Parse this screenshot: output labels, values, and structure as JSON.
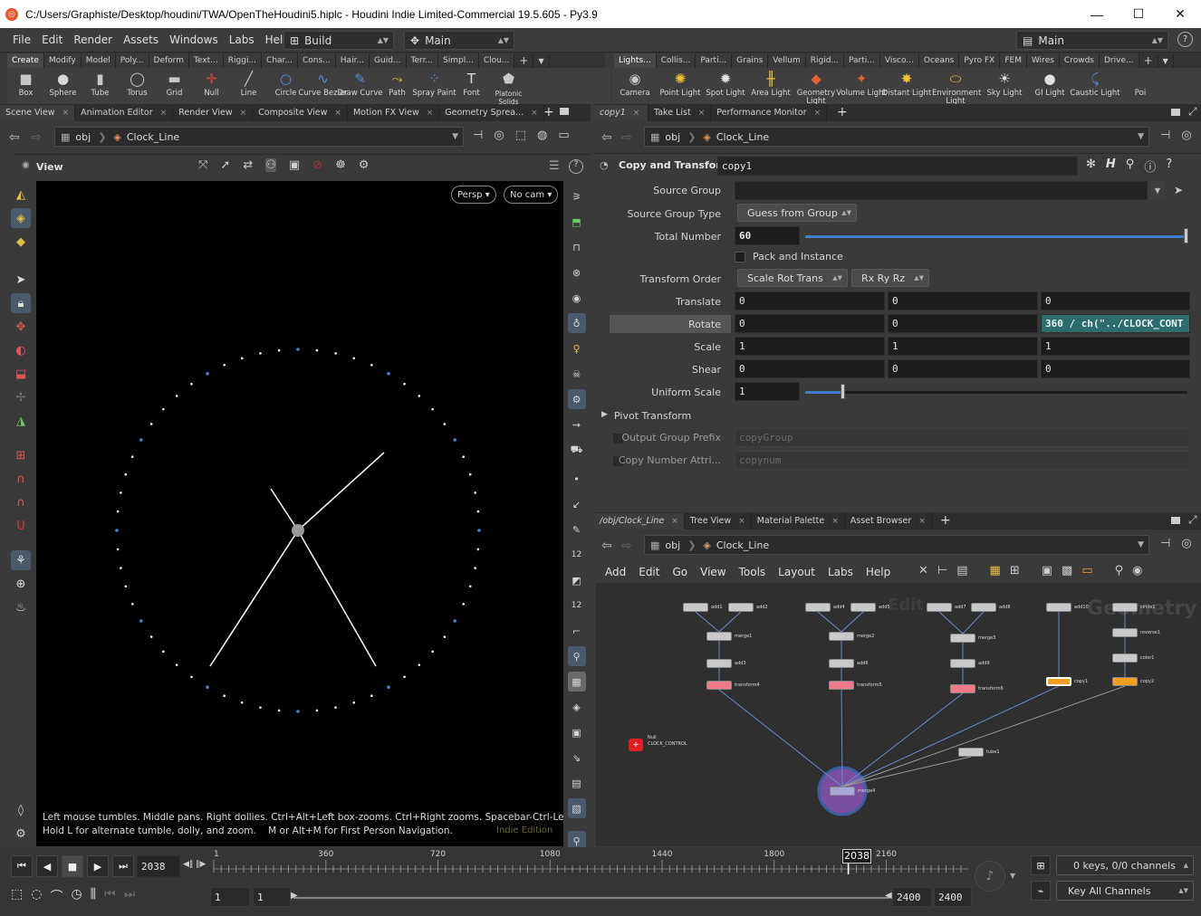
{
  "window": {
    "title": "C:/Users/Graphiste/Desktop/houdini/TWA/OpenTheHoudini5.hiplc - Houdini Indie Limited-Commercial 19.5.605 - Py3.9",
    "min": "—",
    "max": "☐",
    "close": "✕"
  },
  "menu": [
    "File",
    "Edit",
    "Render",
    "Assets",
    "Windows",
    "Labs",
    "Help"
  ],
  "desktop": {
    "build": "Build",
    "main": "Main",
    "right_main": "Main",
    "help": "?"
  },
  "shelf_tabs_left": [
    "Create",
    "Modify",
    "Model",
    "Poly...",
    "Deform",
    "Text...",
    "Riggi...",
    "Char...",
    "Cons...",
    "Hair...",
    "Guid...",
    "Terr...",
    "Simpl...",
    "Clou..."
  ],
  "shelf_tabs_right": [
    "Lights...",
    "Collis...",
    "Parti...",
    "Grains",
    "Vellum",
    "Rigid...",
    "Parti...",
    "Visco...",
    "Oceans",
    "Pyro FX",
    "FEM",
    "Wires",
    "Crowds",
    "Drive..."
  ],
  "tools_left": [
    {
      "label": "Box",
      "icon": "box-icon",
      "glyph": "■",
      "color": "#c8c8c8"
    },
    {
      "label": "Sphere",
      "icon": "sphere-icon",
      "glyph": "●",
      "color": "#d8d8d8"
    },
    {
      "label": "Tube",
      "icon": "tube-icon",
      "glyph": "▮",
      "color": "#c8c8c8"
    },
    {
      "label": "Torus",
      "icon": "torus-icon",
      "glyph": "◯",
      "color": "#c8c8c8"
    },
    {
      "label": "Grid",
      "icon": "grid-icon",
      "glyph": "▬",
      "color": "#c8c8c8"
    },
    {
      "label": "Null",
      "icon": "null-icon",
      "glyph": "✛",
      "color": "#e0473b"
    },
    {
      "label": "Line",
      "icon": "line-icon",
      "glyph": "╱",
      "color": "#c8c8c8"
    },
    {
      "label": "Circle",
      "icon": "circle-icon",
      "glyph": "○",
      "color": "#5a8ed8"
    },
    {
      "label": "Curve Bezier",
      "icon": "curve-bezier-icon",
      "glyph": "∿",
      "color": "#5a8ed8"
    },
    {
      "label": "Draw Curve",
      "icon": "draw-curve-icon",
      "glyph": "✎",
      "color": "#5a8ed8"
    },
    {
      "label": "Path",
      "icon": "path-icon",
      "glyph": "⤳",
      "color": "#e0c340"
    },
    {
      "label": "Spray Paint",
      "icon": "spray-paint-icon",
      "glyph": "⁘",
      "color": "#5a8ed8"
    },
    {
      "label": "Font",
      "icon": "font-icon",
      "glyph": "T",
      "color": "#dddddd"
    },
    {
      "label": "Platonic Solids",
      "icon": "platonic-solids-icon",
      "glyph": "⬟",
      "color": "#c8c8c8"
    }
  ],
  "tools_right": [
    {
      "label": "Camera",
      "icon": "camera-icon",
      "glyph": "◉",
      "color": "#c8c8c8"
    },
    {
      "label": "Point Light",
      "icon": "point-light-icon",
      "glyph": "✺",
      "color": "#f0c030"
    },
    {
      "label": "Spot Light",
      "icon": "spot-light-icon",
      "glyph": "✹",
      "color": "#e0e0e0"
    },
    {
      "label": "Area Light",
      "icon": "area-light-icon",
      "glyph": "╫",
      "color": "#f0c030"
    },
    {
      "label": "Geometry Light",
      "icon": "geometry-light-icon",
      "glyph": "◆",
      "color": "#e06030"
    },
    {
      "label": "Volume Light",
      "icon": "volume-light-icon",
      "glyph": "✦",
      "color": "#e06030"
    },
    {
      "label": "Distant Light",
      "icon": "distant-light-icon",
      "glyph": "✸",
      "color": "#f0c030"
    },
    {
      "label": "Environment Light",
      "icon": "environment-light-icon",
      "glyph": "⬭",
      "color": "#f0c030"
    },
    {
      "label": "Sky Light",
      "icon": "sky-light-icon",
      "glyph": "☀",
      "color": "#e0e0e0"
    },
    {
      "label": "GI Light",
      "icon": "gi-light-icon",
      "glyph": "●",
      "color": "#e0e0e0"
    },
    {
      "label": "Caustic Light",
      "icon": "caustic-light-icon",
      "glyph": "⤹",
      "color": "#5a8ed8"
    },
    {
      "label": "Poi",
      "icon": "portal-light-icon",
      "glyph": "",
      "color": "#e0e0e0"
    }
  ],
  "left_pane_tabs": [
    "Scene View",
    "Animation Editor",
    "Render View",
    "Composite View",
    "Motion FX View",
    "Geometry Sprea..."
  ],
  "right_top_tabs": [
    "copy1",
    "Take List",
    "Performance Monitor"
  ],
  "net_tabs": [
    "/obj/Clock_Line",
    "Tree View",
    "Material Palette",
    "Asset Browser"
  ],
  "path": {
    "context": "obj",
    "node": "Clock_Line"
  },
  "viewer": {
    "title": "View",
    "persp": "Persp ▾",
    "cam": "No cam ▾",
    "help_line1": "Left mouse tumbles. Middle pans. Right dollies. Ctrl+Alt+Left box-zooms. Ctrl+Right zooms. Spacebar-Ctrl-Left tilts.",
    "help_line2": "Hold L for alternate tumble, dolly, and zoom.    M or Alt+M for First Person Navigation.",
    "edition": "Indie Edition"
  },
  "params": {
    "node_type": "Copy and Transform",
    "node_name": "copy1",
    "source_group_label": "Source Group",
    "source_group_value": "",
    "source_group_type_label": "Source Group Type",
    "source_group_type_value": "Guess from Group",
    "total_number_label": "Total Number",
    "total_number_value": "60",
    "pack_label": "Pack and Instance",
    "transform_order_label": "Transform Order",
    "transform_order_value": "Scale Rot Trans",
    "rotate_order_value": "Rx Ry Rz",
    "translate_label": "Translate",
    "translate": [
      "0",
      "0",
      "0"
    ],
    "rotate_label": "Rotate",
    "rotate": [
      "0",
      "0",
      "360 / ch(\"../CLOCK_CONT"
    ],
    "scale_label": "Scale",
    "scale": [
      "1",
      "1",
      "1"
    ],
    "shear_label": "Shear",
    "shear": [
      "0",
      "0",
      "0"
    ],
    "uniform_scale_label": "Uniform Scale",
    "uniform_scale_value": "1",
    "pivot_label": "Pivot Transform",
    "output_group_label": "Output Group Prefix",
    "output_group_value": "copyGroup",
    "copy_number_label": "Copy Number Attri...",
    "copy_number_value": "copynum"
  },
  "network": {
    "menu": [
      "Add",
      "Edit",
      "Go",
      "View",
      "Tools",
      "Layout",
      "Labs",
      "Help"
    ],
    "watermark_a": "Edit",
    "watermark_b": "Geometry",
    "nodes": [
      "add1",
      "add2",
      "merge1",
      "add3",
      "transform4",
      "add4",
      "add5",
      "merge2",
      "add6",
      "transform5",
      "add7",
      "add8",
      "merge3",
      "add9",
      "transform6",
      "add10",
      "copy1",
      "circle1",
      "reverse1",
      "color1",
      "copy2",
      "tube1",
      "merge4",
      "CLOCK_CONTROL"
    ],
    "null_label": "Null"
  },
  "timeline": {
    "frame": "2038",
    "marker": "2038",
    "ticks": [
      "1",
      "360",
      "720",
      "1080",
      "1440",
      "1800",
      "2160"
    ],
    "start": "1",
    "start2": "1",
    "end": "2400",
    "end2": "2400",
    "keys": "0 keys, 0/0 channels",
    "key_all": "Key All Channels"
  }
}
